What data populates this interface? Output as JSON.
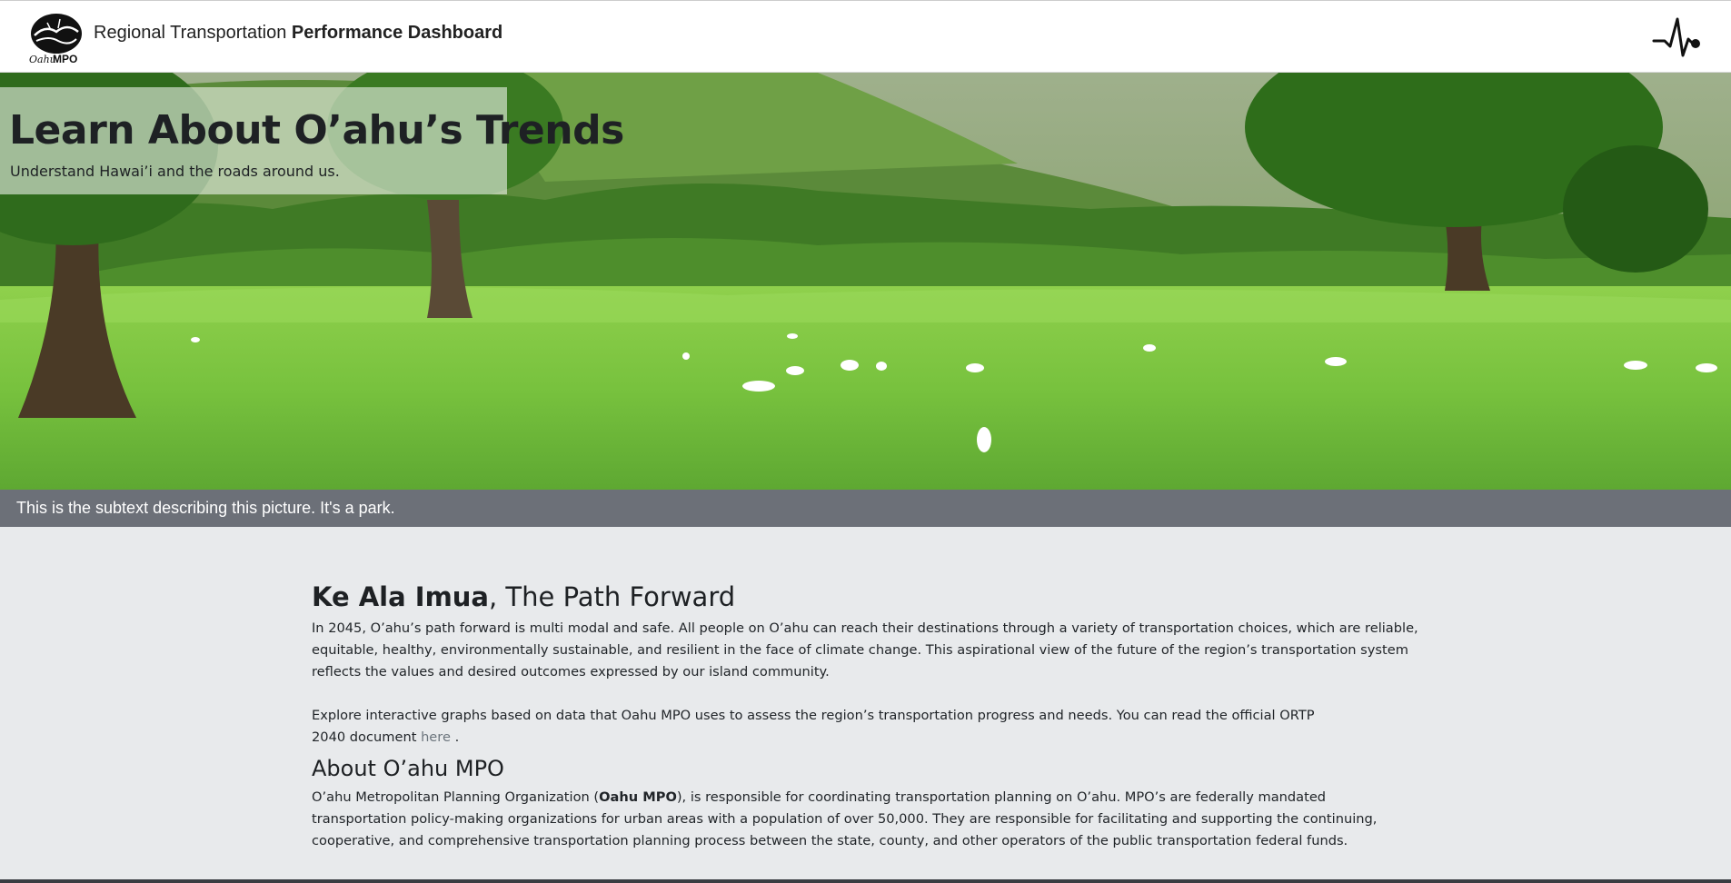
{
  "header": {
    "logo_text": "OahuMPO",
    "title_regular": "Regional Transportation",
    "title_bold": "Performance Dashboard"
  },
  "hero": {
    "title": "Learn About O’ahu’s Trends",
    "subtitle": "Understand Hawai’i and the roads around us.",
    "caption": "This is the subtext describing this picture. It's a park."
  },
  "path_forward": {
    "title_bold": "Ke Ala Imua",
    "title_rest": ", The Path Forward",
    "paragraph": "In 2045, O’ahu’s path forward is multi modal and safe. All people on O’ahu can reach their destinations through a variety of transportation choices, which are reliable, equitable, healthy, environmentally sustainable, and resilient in the face of climate change. This aspirational view of the future of the region’s transportation system reflects the values and desired outcomes expressed by our island community.",
    "explore_text": "Explore interactive graphs based on data that Oahu MPO uses to assess the region’s transportation progress and needs. You can read the official ORTP 2040 document",
    "link_text": "here",
    "after_link": "."
  },
  "about": {
    "title": "About O’ahu MPO",
    "p_start": "O’ahu Metropolitan Planning Organization (",
    "p_bold": "Oahu MPO",
    "p_rest": "), is responsible for coordinating transportation planning on O’ahu. MPO’s are federally mandated transportation policy-making organizations for urban areas with a population of over 50,000. They are responsible for facilitating and supporting the continuing, cooperative, and comprehensive transportation planning process between the state, county, and other operators of the public transportation federal funds."
  },
  "icons": {
    "logo": "oahu-mpo-logo",
    "activity": "heartbeat-pulse-icon"
  },
  "colors": {
    "caption_bg": "#6c7078",
    "page_bg": "#e8eaec",
    "grass": "#7cc242"
  }
}
